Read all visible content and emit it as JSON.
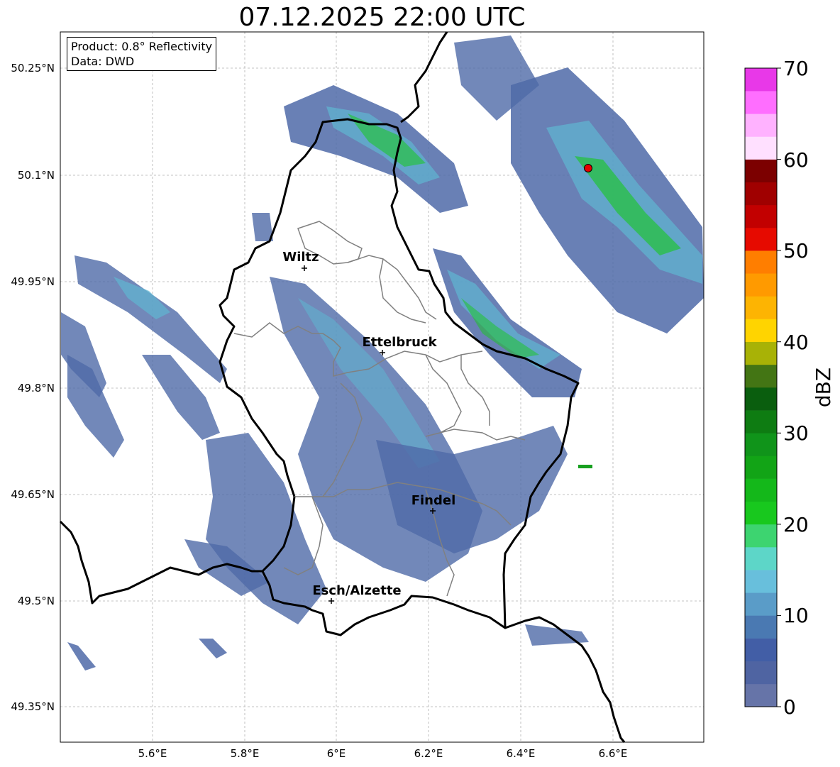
{
  "title": "07.12.2025 22:00 UTC",
  "info": {
    "product": "Product: 0.8° Reflectivity",
    "data_source": "Data: DWD"
  },
  "lon_ticks": [
    "5.6°E",
    "5.8°E",
    "6°E",
    "6.2°E",
    "6.4°E",
    "6.6°E"
  ],
  "lat_ticks": [
    "50.25°N",
    "50.1°N",
    "49.95°N",
    "49.8°N",
    "49.65°N",
    "49.5°N",
    "49.35°N"
  ],
  "cities": [
    {
      "name": "Wiltz"
    },
    {
      "name": "Ettelbruck"
    },
    {
      "name": "Findel"
    },
    {
      "name": "Esch/Alzette"
    }
  ],
  "colorbar": {
    "label": "dBZ",
    "ticks": [
      "0",
      "10",
      "20",
      "30",
      "40",
      "50",
      "60",
      "70"
    ],
    "colors": [
      "#6674a8",
      "#4f64a2",
      "#425ea6",
      "#4a79b2",
      "#5a9cc8",
      "#68bfdc",
      "#5dd6c8",
      "#3dd470",
      "#18c81e",
      "#14b81a",
      "#12a416",
      "#10941a",
      "#0e7c12",
      "#0a5e0e",
      "#437514",
      "#a8b206",
      "#ffd400",
      "#fdb402",
      "#ff9a00",
      "#ff7e00",
      "#e60a00",
      "#c20000",
      "#a00000",
      "#7c0000",
      "#ffe0ff",
      "#ffb2ff",
      "#ff6eff",
      "#e838e8"
    ]
  },
  "radar_site_color": "#e60000"
}
